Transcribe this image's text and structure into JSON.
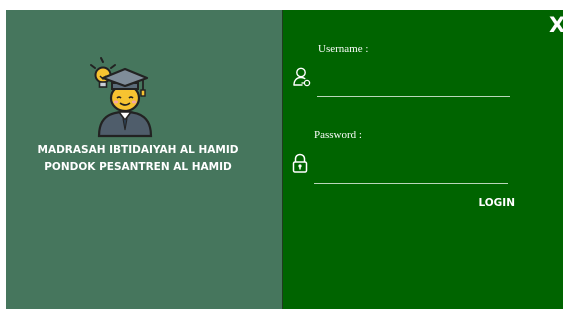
{
  "window": {
    "close_label": "X"
  },
  "branding": {
    "logo_icon": "graduate-student-lightbulb-icon",
    "school_name_line1": "MADRASAH IBTIDAIYAH AL HAMID",
    "school_name_line2": "PONDOK PESANTREN AL HAMID"
  },
  "login_form": {
    "username_label": "Username :",
    "username_icon": "user-key-icon",
    "username_value": "",
    "password_label": "Password :",
    "password_icon": "padlock-icon",
    "password_value": "",
    "login_label": "LOGIN"
  },
  "colors": {
    "left_panel_bg": "#46765d",
    "right_panel_bg": "#006400",
    "text": "#ffffff"
  }
}
